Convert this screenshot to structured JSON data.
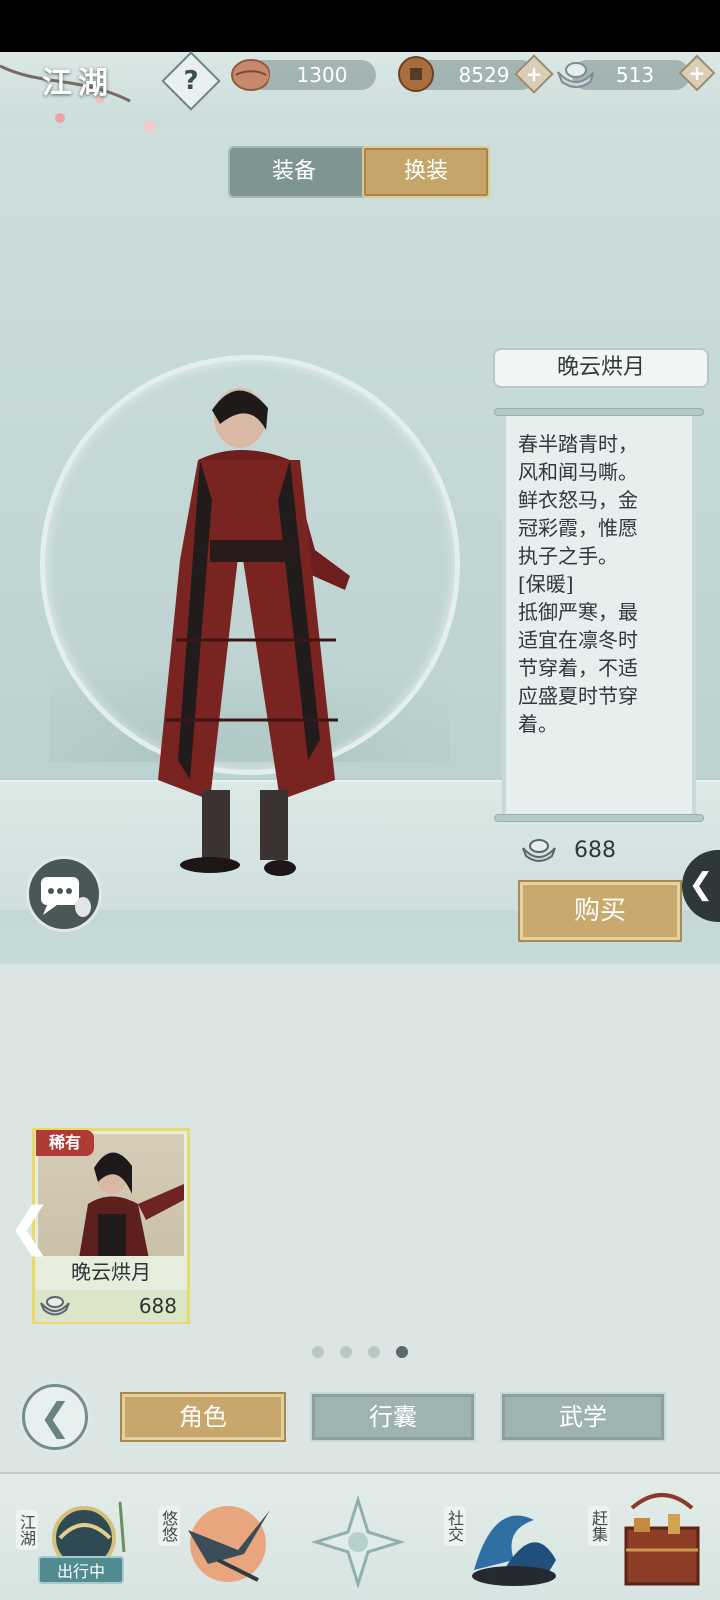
{
  "header": {
    "region_title": "江湖",
    "help_label": "?",
    "currencies": [
      {
        "icon": "shell-icon",
        "value": "1300",
        "color": "#b97a5e"
      },
      {
        "icon": "copper-coin-icon",
        "value": "8529",
        "color": "#9c6b3b"
      },
      {
        "icon": "silver-ingot-icon",
        "value": "513",
        "color": "#c5cfd4"
      }
    ],
    "plus_label": "+"
  },
  "tabs": {
    "equip_label": "装备",
    "outfit_label": "换装",
    "active": "换装"
  },
  "outfit": {
    "name": "晚云烘月",
    "description": "春半踏青时，\n风和闻马嘶。\n鲜衣怒马，金\n冠彩霞，惟愿\n执子之手。\n[保暖]\n抵御严寒，最\n适宜在凛冬时\n节穿着，不适\n应盛夏时节穿\n着。",
    "price": "688",
    "buy_label": "购买"
  },
  "item_list": {
    "cards": [
      {
        "rarity": "稀有",
        "name": "晚云烘月",
        "price": "688"
      }
    ],
    "page_count": 4,
    "active_page": 4
  },
  "bottom_tabs": [
    {
      "label": "角色",
      "active": true
    },
    {
      "label": "行囊",
      "active": false
    },
    {
      "label": "武学",
      "active": false
    }
  ],
  "bottom_nav": [
    {
      "label": "江湖",
      "icon": "jianghu-icon"
    },
    {
      "label": "悠悠",
      "icon": "youyou-bird-icon"
    },
    {
      "label": "",
      "icon": "compass-star-icon"
    },
    {
      "label": "社交",
      "icon": "social-wave-icon"
    },
    {
      "label": "赶集",
      "icon": "market-basket-icon"
    }
  ],
  "out_badge": "出行中"
}
